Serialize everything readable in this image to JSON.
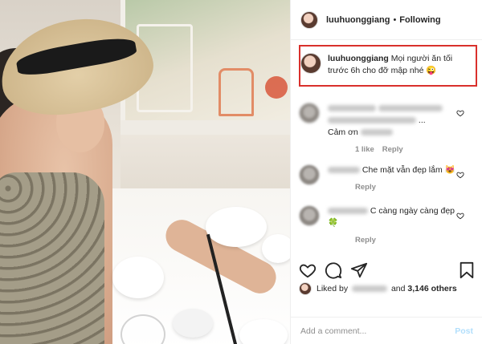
{
  "header": {
    "username": "luuhuonggiang",
    "separator": "•",
    "follow_status": "Following"
  },
  "caption": {
    "username": "luuhuonggiang",
    "text": "Mọi người ăn tối trước 6h cho đỡ mập nhé 😜"
  },
  "comments": [
    {
      "line2_suffix": "...",
      "line3": "Cảm ơn",
      "likes": "1 like",
      "reply": "Reply"
    },
    {
      "text": "Che mặt vẫn đẹp lắm 😻",
      "reply": "Reply"
    },
    {
      "text": "C càng ngày càng đẹp 🍀",
      "reply": "Reply"
    }
  ],
  "liked_by": {
    "prefix": "Liked by",
    "and_text": "and",
    "others": "3,146 others"
  },
  "add_comment": {
    "placeholder": "Add a comment...",
    "post_label": "Post"
  },
  "colors": {
    "highlight_border": "#d9302c",
    "post_button": "#b2dffc",
    "secondary_text": "#8e8e8e"
  },
  "icons": [
    "heart-icon",
    "comment-icon",
    "share-icon",
    "bookmark-icon"
  ]
}
